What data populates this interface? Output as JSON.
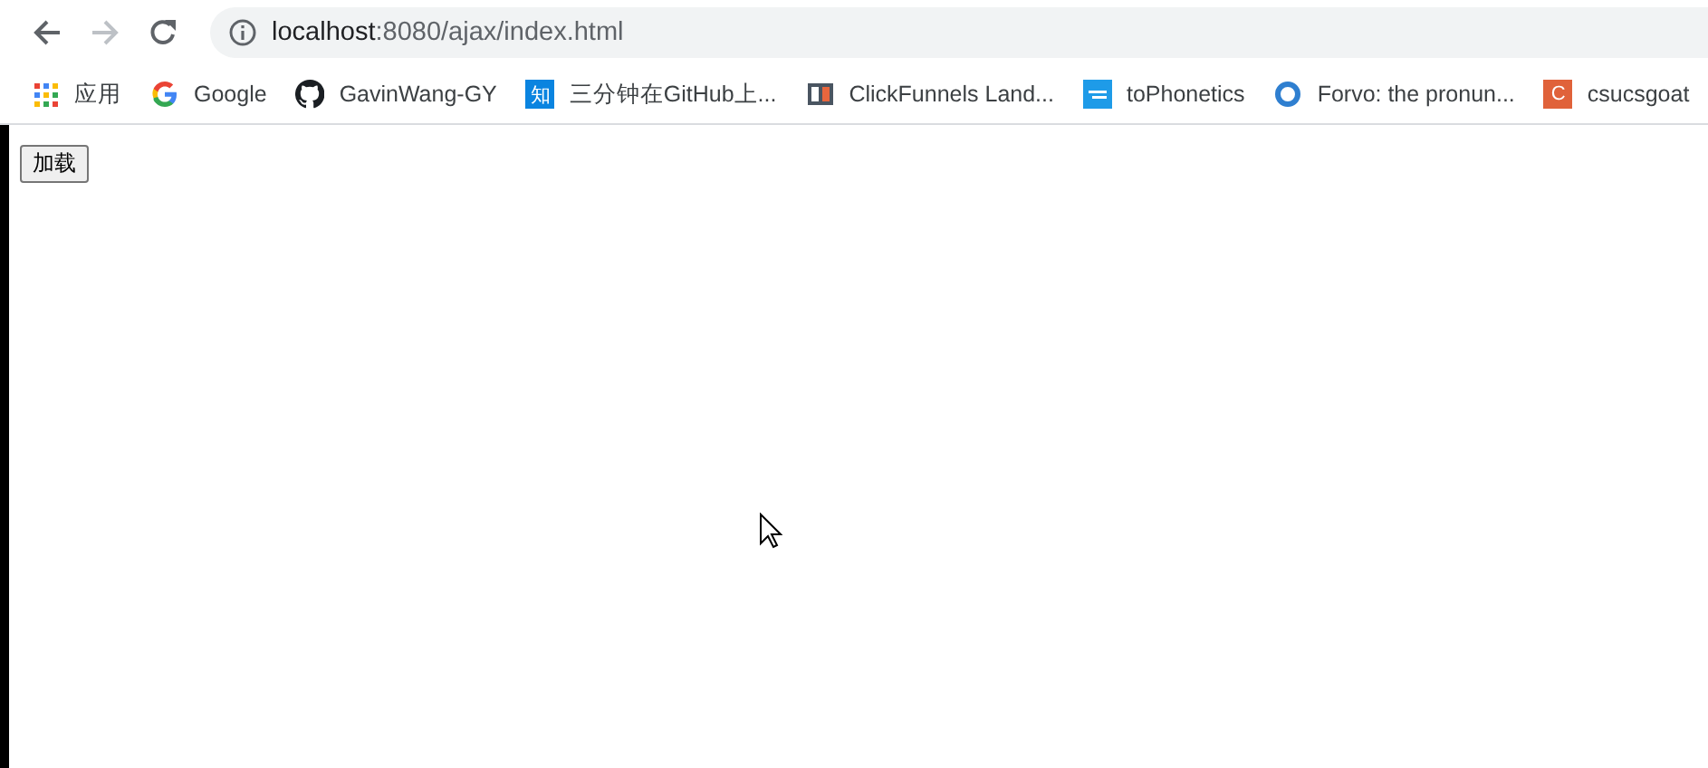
{
  "address_bar": {
    "url_host": "localhost",
    "url_rest": ":8080/ajax/index.html"
  },
  "bookmarks": [
    {
      "kind": "apps",
      "label": "应用"
    },
    {
      "kind": "google",
      "label": "Google"
    },
    {
      "kind": "github",
      "label": "GavinWang-GY"
    },
    {
      "kind": "badge",
      "glyph": "知",
      "color": "#0a84e0",
      "label": "三分钟在GitHub上..."
    },
    {
      "kind": "funnel",
      "label": "ClickFunnels Land..."
    },
    {
      "kind": "tile",
      "color": "#1e9be8",
      "label": "toPhonetics"
    },
    {
      "kind": "ring",
      "label": "Forvo: the pronun..."
    },
    {
      "kind": "badge",
      "glyph": "C",
      "color": "#e0623a",
      "label": "csucsgoat"
    }
  ],
  "page": {
    "button": "加载"
  }
}
